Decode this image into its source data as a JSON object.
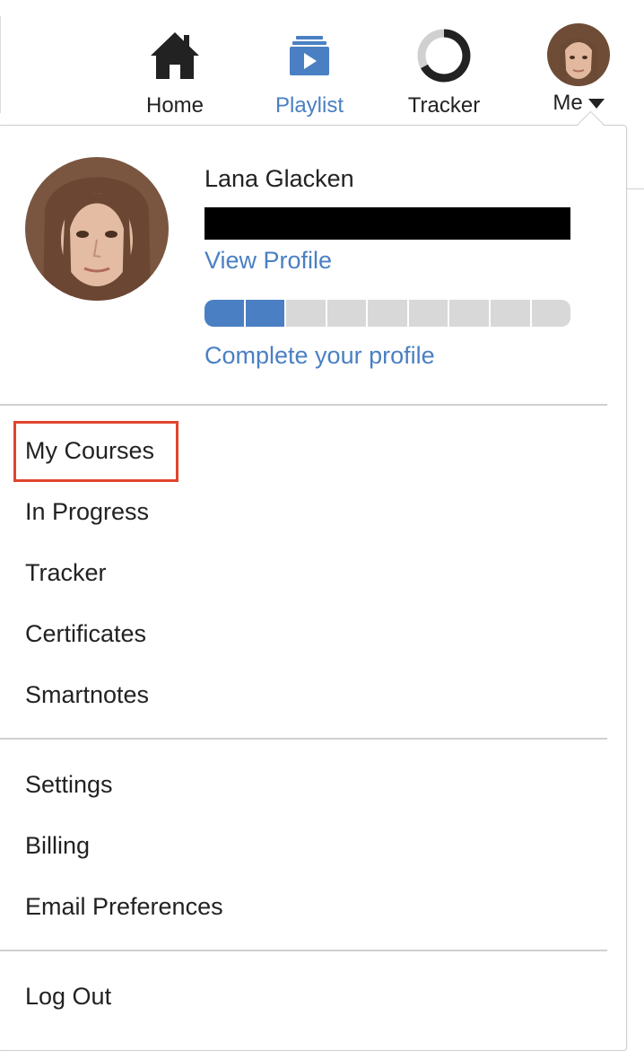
{
  "nav": {
    "items": [
      {
        "label": "Home",
        "icon": "home-icon",
        "active": false
      },
      {
        "label": "Playlist",
        "icon": "playlist-icon",
        "active": true
      },
      {
        "label": "Tracker",
        "icon": "tracker-ring-icon",
        "active": false
      }
    ],
    "me_label": "Me"
  },
  "profile": {
    "name": "Lana Glacken",
    "view_profile": "View Profile",
    "progress": {
      "completed_segments": 2,
      "total_segments": 9
    },
    "complete_profile": "Complete your profile"
  },
  "menu": {
    "section1": [
      "My Courses",
      "In Progress",
      "Tracker",
      "Certificates",
      "Smartnotes"
    ],
    "section2": [
      "Settings",
      "Billing",
      "Email Preferences"
    ],
    "section3": [
      "Log Out"
    ]
  },
  "colors": {
    "accent": "#4a80c3",
    "highlight": "#e0442d",
    "divider": "#cfcfcf"
  }
}
